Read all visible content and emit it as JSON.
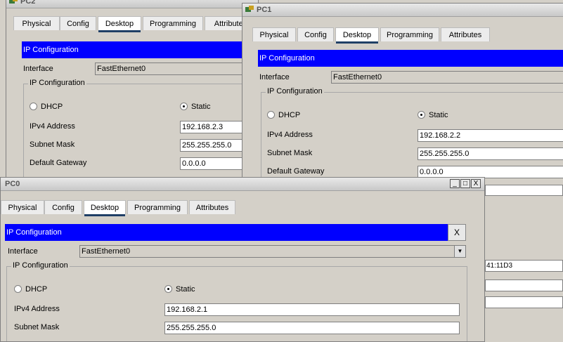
{
  "windows": [
    {
      "title": "PC2",
      "tabs": [
        "Physical",
        "Config",
        "Desktop",
        "Programming",
        "Attributes"
      ],
      "active_tab": "Desktop",
      "ip_configuration_bar": "IP Configuration",
      "interface_label": "Interface",
      "interface_value": "FastEthernet0",
      "group_title": "IP Configuration",
      "dhcp_label": "DHCP",
      "static_label": "Static",
      "selected_mode": "Static",
      "ipv4_label": "IPv4 Address",
      "ipv4_value": "192.168.2.3",
      "subnet_label": "Subnet Mask",
      "subnet_value": "255.255.255.0",
      "gateway_label": "Default Gateway",
      "gateway_value": "0.0.0.0"
    },
    {
      "title": "PC1",
      "tabs": [
        "Physical",
        "Config",
        "Desktop",
        "Programming",
        "Attributes"
      ],
      "active_tab": "Desktop",
      "ip_configuration_bar": "IP Configuration",
      "interface_label": "Interface",
      "interface_value": "FastEthernet0",
      "group_title": "IP Configuration",
      "dhcp_label": "DHCP",
      "static_label": "Static",
      "selected_mode": "Static",
      "ipv4_label": "IPv4 Address",
      "ipv4_value": "192.168.2.2",
      "subnet_label": "Subnet Mask",
      "subnet_value": "255.255.255.0",
      "gateway_label": "Default Gateway",
      "gateway_value": "0.0.0.0"
    },
    {
      "title": "PC0",
      "tabs": [
        "Physical",
        "Config",
        "Desktop",
        "Programming",
        "Attributes"
      ],
      "active_tab": "Desktop",
      "ip_configuration_bar": "IP Configuration",
      "close_x": "X",
      "interface_label": "Interface",
      "interface_value": "FastEthernet0",
      "group_title": "IP Configuration",
      "dhcp_label": "DHCP",
      "static_label": "Static",
      "selected_mode": "Static",
      "ipv4_label": "IPv4 Address",
      "ipv4_value": "192.168.2.1",
      "subnet_label": "Subnet Mask",
      "subnet_value": "255.255.255.0",
      "window_controls": [
        "_",
        "□",
        "X"
      ]
    }
  ],
  "background": {
    "partial_field_text": "41:11D3"
  },
  "colors": {
    "ip_bar_blue": "#0000ff",
    "active_tab_underline": "#1f3f66",
    "window_bg": "#d4d0c8"
  }
}
